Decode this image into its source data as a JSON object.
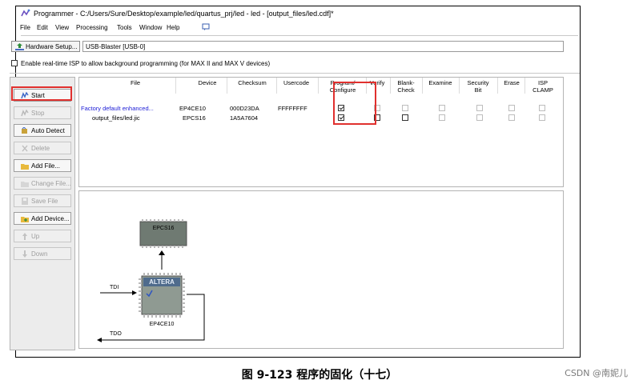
{
  "window": {
    "title": "Programmer - C:/Users/Sure/Desktop/example/led/quartus_prj/led - led - [output_files/led.cdf]*"
  },
  "menu": [
    "File",
    "Edit",
    "View",
    "Processing",
    "Tools",
    "Window",
    "Help"
  ],
  "hardware": {
    "setup_label": "Hardware Setup...",
    "value": "USB-Blaster [USB-0]"
  },
  "isp_option": {
    "label": "Enable real-time ISP to allow background programming (for MAX II and MAX V devices)",
    "checked": false
  },
  "sidebar": {
    "start": "Start",
    "stop": "Stop",
    "auto_detect": "Auto Detect",
    "delete": "Delete",
    "add_file": "Add File...",
    "change_file": "Change File...",
    "save_file": "Save File",
    "add_device": "Add Device...",
    "up": "Up",
    "down": "Down"
  },
  "table": {
    "headers": {
      "file": "File",
      "device": "Device",
      "checksum": "Checksum",
      "usercode": "Usercode",
      "program": [
        "Program/",
        "Configure"
      ],
      "verify": "Verify",
      "blank": [
        "Blank-",
        "Check"
      ],
      "examine": "Examine",
      "security": [
        "Security",
        "Bit"
      ],
      "erase": "Erase",
      "isp": [
        "ISP",
        "CLAMP"
      ]
    },
    "rows": [
      {
        "file": "Factory default enhanced...",
        "device": "EP4CE10",
        "checksum": "000D23DA",
        "usercode": "FFFFFFFF",
        "program": true
      },
      {
        "file": "output_files/led.jic",
        "device": "EPCS16",
        "checksum": "1A5A7604",
        "usercode": "",
        "program": true
      }
    ]
  },
  "chain": {
    "top_chip": "EPCS16",
    "main_chip": "EP4CE10",
    "logo": "ALTERA",
    "tdi": "TDI",
    "tdo": "TDO"
  },
  "caption": "图 9-123  程序的固化（十七）",
  "watermark": "CSDN @南妮儿",
  "colors": {
    "highlight": "#e0302e",
    "link": "#1b1bd6"
  }
}
